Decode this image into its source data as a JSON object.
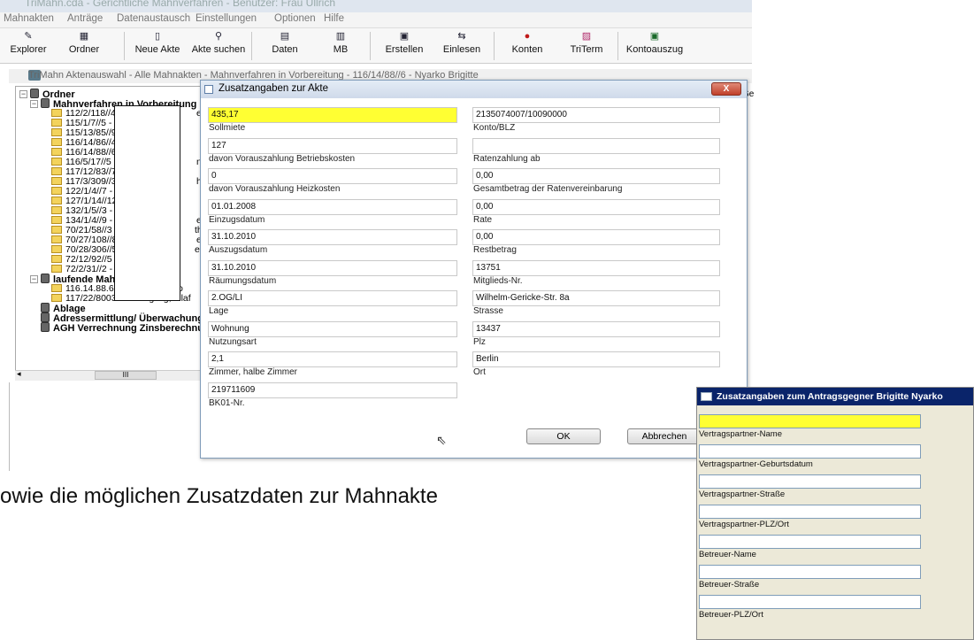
{
  "window": {
    "title": "TriMahn.cda - Gerichtliche Mahnverfahren - Benutzer: Frau Ullrich"
  },
  "menu": [
    "Mahnakten",
    "Anträge",
    "Datenaustausch",
    "Einstellungen",
    "Optionen",
    "Hilfe"
  ],
  "toolbar": {
    "explorer": "Explorer",
    "ordner": "Ordner",
    "neue_akte": "Neue Akte",
    "akte_suchen": "Akte suchen",
    "daten": "Daten",
    "mb": "MB",
    "erstellen": "Erstellen",
    "einlesen": "Einlesen",
    "konten": "Konten",
    "triterm": "TriTerm",
    "kontoauszug": "Kontoauszug"
  },
  "bg_window": {
    "title": "TriMahn Aktenauswahl - Alle Mahnakten - Mahnverfahren in Vorbereitung - 116/14/88//6 - Nyarko Brigitte"
  },
  "tree": {
    "root": "Ordner",
    "group1": "Mahnverfahren in Vorbereitung",
    "group1_items": [
      "112/2/118//4 -",
      "115/1/7//5 -",
      "115/13/85//9 -",
      "116/14/86//4 -",
      "116/14/88//6 -",
      "116/5/17//5 -",
      "117/12/83//7 -",
      "117/3/309//3 -",
      "122/1/4//7 -",
      "127/1/14//12 -",
      "132/1/5//3 -",
      "134/1/4//9 -",
      "70/21/58//3 -",
      "70/27/108//8 -",
      "70/28/306//5 -",
      "72/12/92//5 -",
      "72/2/31//2 - Trommler Maxi"
    ],
    "group1_suffix": {
      "0": "e",
      "5": "n",
      "7": "h",
      "11": "e",
      "12": "tha",
      "13": "e",
      "14": "erhard"
    },
    "group2": "laufende Mahnverfahren",
    "group2_items": [
      "116.14.88.6 - Brigitte Nyarko",
      "117/22/80035/2 - Engling, Olaf"
    ],
    "group3": "Ablage",
    "group4": "Adressermittlung/ Überwachunge",
    "group5": "AGH Verrechnung Zinsberechnun",
    "scroll_thumb": "III"
  },
  "right_col_header": "Ge",
  "dialog1": {
    "title": "Zusatzangaben zur Akte",
    "close": "X",
    "left_fields": [
      {
        "value": "435,17",
        "caption": "Sollmiete"
      },
      {
        "value": "127",
        "caption": "davon Vorauszahlung Betriebskosten"
      },
      {
        "value": "0",
        "caption": "davon Vorauszahlung Heizkosten"
      },
      {
        "value": "01.01.2008",
        "caption": "Einzugsdatum"
      },
      {
        "value": "31.10.2010",
        "caption": "Auszugsdatum"
      },
      {
        "value": "31.10.2010",
        "caption": "Räumungsdatum"
      },
      {
        "value": "2.OG/LI",
        "caption": "Lage"
      },
      {
        "value": "Wohnung",
        "caption": "Nutzungsart"
      },
      {
        "value": "2,1",
        "caption": "Zimmer, halbe Zimmer"
      },
      {
        "value": "219711609",
        "caption": "BK01-Nr."
      }
    ],
    "right_fields": [
      {
        "value": "2135074007/10090000",
        "caption": "Konto/BLZ"
      },
      {
        "value": "",
        "caption": "Ratenzahlung ab"
      },
      {
        "value": "0,00",
        "caption": "Gesamtbetrag der Ratenvereinbarung"
      },
      {
        "value": "0,00",
        "caption": "Rate"
      },
      {
        "value": "0,00",
        "caption": "Restbetrag"
      },
      {
        "value": "13751",
        "caption": "Mitglieds-Nr."
      },
      {
        "value": "Wilhelm-Gericke-Str. 8a",
        "caption": "Strasse"
      },
      {
        "value": "13437",
        "caption": "Plz"
      },
      {
        "value": "Berlin",
        "caption": "Ort"
      }
    ],
    "ok": "OK",
    "cancel": "Abbrechen"
  },
  "dialog2": {
    "title": "Zusatzangaben zum Antragsgegner Brigitte Nyarko",
    "fields": [
      "Vertragspartner-Name",
      "Vertragspartner-Geburtsdatum",
      "Vertragspartner-Straße",
      "Vertragspartner-PLZ/Ort",
      "Betreuer-Name",
      "Betreuer-Straße",
      "Betreuer-PLZ/Ort"
    ]
  },
  "caption": "owie die möglichen Zusatzdaten zur Mahnakte"
}
